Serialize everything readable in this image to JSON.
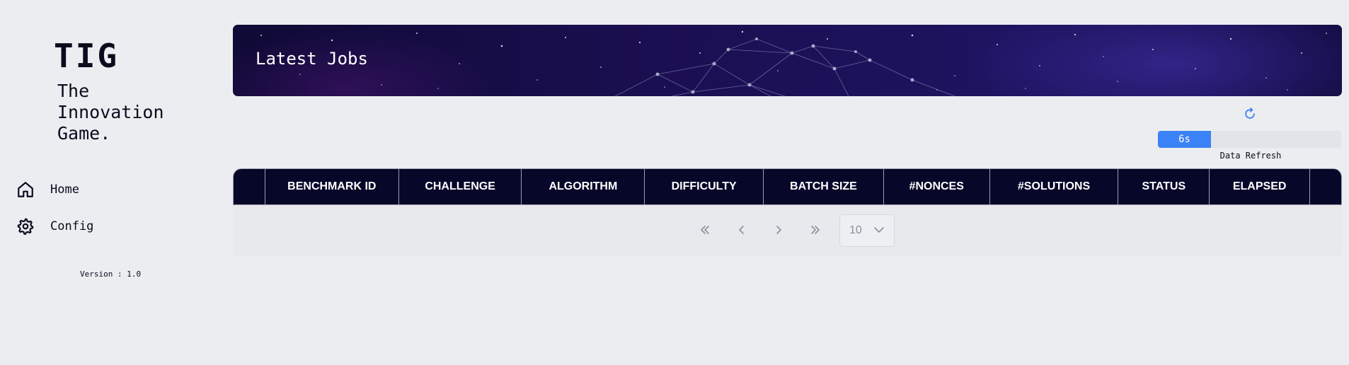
{
  "sidebar": {
    "logo_title": "TIG",
    "logo_subtitle": "The\nInnovation\nGame.",
    "items": [
      {
        "label": "Home",
        "icon": "home-icon"
      },
      {
        "label": "Config",
        "icon": "gear-icon"
      }
    ],
    "version": "Version : 1.0"
  },
  "banner": {
    "title": "Latest Jobs"
  },
  "refresh": {
    "icon": "refresh-icon",
    "countdown": "6s",
    "progress_fraction": 0.29,
    "label": "Data Refresh",
    "accent_color": "#3b82f6"
  },
  "table": {
    "columns": [
      "",
      "BENCHMARK ID",
      "CHALLENGE",
      "ALGORITHM",
      "DIFFICULTY",
      "BATCH SIZE",
      "#NONCES",
      "#SOLUTIONS",
      "STATUS",
      "ELAPSED",
      ""
    ],
    "rows": [],
    "header_color": "#07072a"
  },
  "pagination": {
    "first_icon": "double-chevron-left-icon",
    "prev_icon": "chevron-left-icon",
    "next_icon": "chevron-right-icon",
    "last_icon": "double-chevron-right-icon",
    "page_size": "10"
  }
}
